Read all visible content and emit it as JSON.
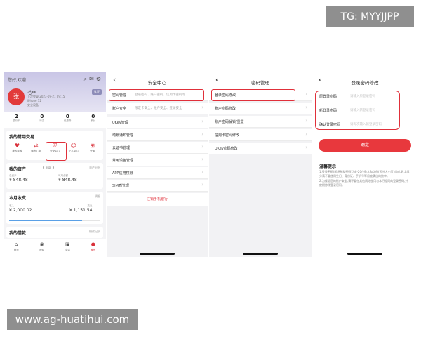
{
  "watermarks": {
    "top": "TG: MYYJJPP",
    "bottom": "www.ag-huatihui.com"
  },
  "screen1": {
    "greeting": "您好,欢迎",
    "user_initial": "张",
    "user_name": "毛**",
    "user_info_line1": "上次登录 2023-09-21 09:15",
    "user_info_line2": "iPhone 12",
    "user_info_line3": "安全设备",
    "badge": "认证",
    "stats": [
      {
        "num": "2",
        "label": "银行卡"
      },
      {
        "num": "0",
        "label": "待办"
      },
      {
        "num": "0",
        "label": "优惠券"
      },
      {
        "num": "0",
        "label": "积分"
      }
    ],
    "common_title": "我的常用交易",
    "functions": [
      {
        "icon": "♥",
        "label": "我的存款"
      },
      {
        "icon": "⇄",
        "label": "转账汇款"
      },
      {
        "icon": "⛨",
        "label": "安全中心"
      },
      {
        "icon": "☺",
        "label": "个人中心"
      },
      {
        "icon": "⊞",
        "label": "全部"
      }
    ],
    "assets_title": "我的资产",
    "assets_toggle": "隐藏",
    "assets_more": "资产分析",
    "assets_total_cap": "总资产",
    "assets_total": "¥ 848.48",
    "assets_avail_cap": "可用余额",
    "assets_avail": "¥ 848.48",
    "income_title": "本月收支",
    "income_more": "明细",
    "income_in_cap": "收入",
    "income_in": "¥ 2,000.02",
    "income_out_cap": "支出",
    "income_out": "¥ 1,151.54",
    "loan_title": "我的借款",
    "loan_more": "借款记录",
    "nav": [
      {
        "icon": "⌂",
        "label": "首页"
      },
      {
        "icon": "◉",
        "label": "理财"
      },
      {
        "icon": "▣",
        "label": "生活"
      },
      {
        "icon": "●",
        "label": "我的"
      }
    ]
  },
  "screen2": {
    "title": "安全中心",
    "rows": [
      {
        "key": "密码管理",
        "value": "登录密码、账户密码、信用卡密码等"
      },
      {
        "key": "账户安全",
        "value": "限定卡安全、账户安全、登录安全"
      },
      {
        "key": "UKey管理",
        "value": ""
      },
      {
        "key": "动账通知管理",
        "value": ""
      },
      {
        "key": "云证书管理",
        "value": ""
      },
      {
        "key": "常用设备管理",
        "value": ""
      },
      {
        "key": "APP信用权限",
        "value": ""
      },
      {
        "key": "SIM盾管理",
        "value": ""
      }
    ],
    "logout": "注销手机银行"
  },
  "screen3": {
    "title": "密码管理",
    "rows": [
      {
        "key": "登录密码修改"
      },
      {
        "key": "账户密码修改"
      },
      {
        "key": "账户密码解锁/重置"
      },
      {
        "key": "信用卡密码修改"
      },
      {
        "key": "UKey密码修改"
      }
    ]
  },
  "screen4": {
    "title": "登录密码修改",
    "fields": [
      {
        "label": "原登录密码",
        "placeholder": "请输入原登录密码"
      },
      {
        "label": "新登录密码",
        "placeholder": "请输入新登录密码"
      },
      {
        "label": "确认登录密码",
        "placeholder": "请再次输入新登录密码"
      }
    ],
    "confirm": "确定",
    "tip_title": "温馨提示",
    "tip_line1": "1.登录密码(即原移动密码)为8-20位数字和字母(区分大小写)组成,数字部分请不要使用生日、身份证、手机号等易被猜出的数字。",
    "tip_line2": "2.为保证您的账户安全,请不要在其他网站使用与本行相同的登录密码,并定期修改登录密码。"
  }
}
